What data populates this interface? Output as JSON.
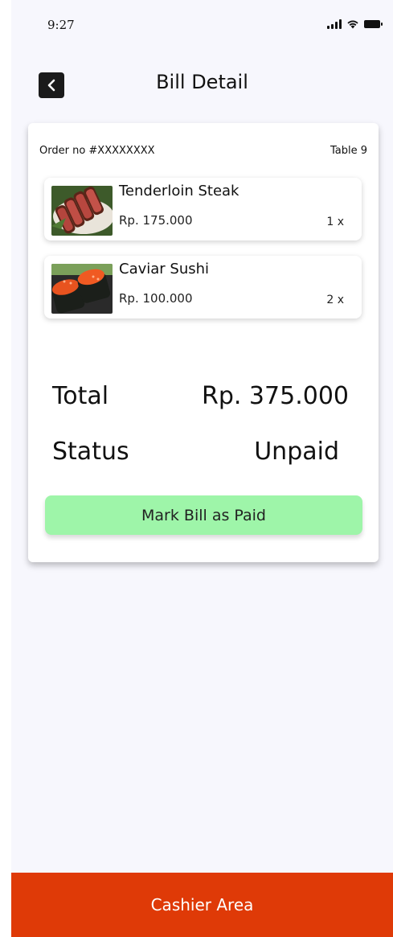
{
  "status_bar": {
    "time": "9:27"
  },
  "header": {
    "title": "Bill Detail"
  },
  "order": {
    "order_no": "Order no #XXXXXXXX",
    "table": "Table 9"
  },
  "items": [
    {
      "name": "Tenderloin Steak",
      "price": "Rp. 175.000",
      "qty": "1 x",
      "icon": "steak-image"
    },
    {
      "name": "Caviar Sushi",
      "price": "Rp. 100.000",
      "qty": "2 x",
      "icon": "sushi-image"
    }
  ],
  "summary": {
    "total_label": "Total",
    "total_value": "Rp. 375.000",
    "status_label": "Status",
    "status_value": "Unpaid"
  },
  "actions": {
    "mark_paid": "Mark Bill as Paid"
  },
  "footer": {
    "label": "Cashier Area"
  },
  "colors": {
    "accent": "#df3a07",
    "paid_button": "#9ef5a9",
    "background": "#f7f7fd"
  }
}
